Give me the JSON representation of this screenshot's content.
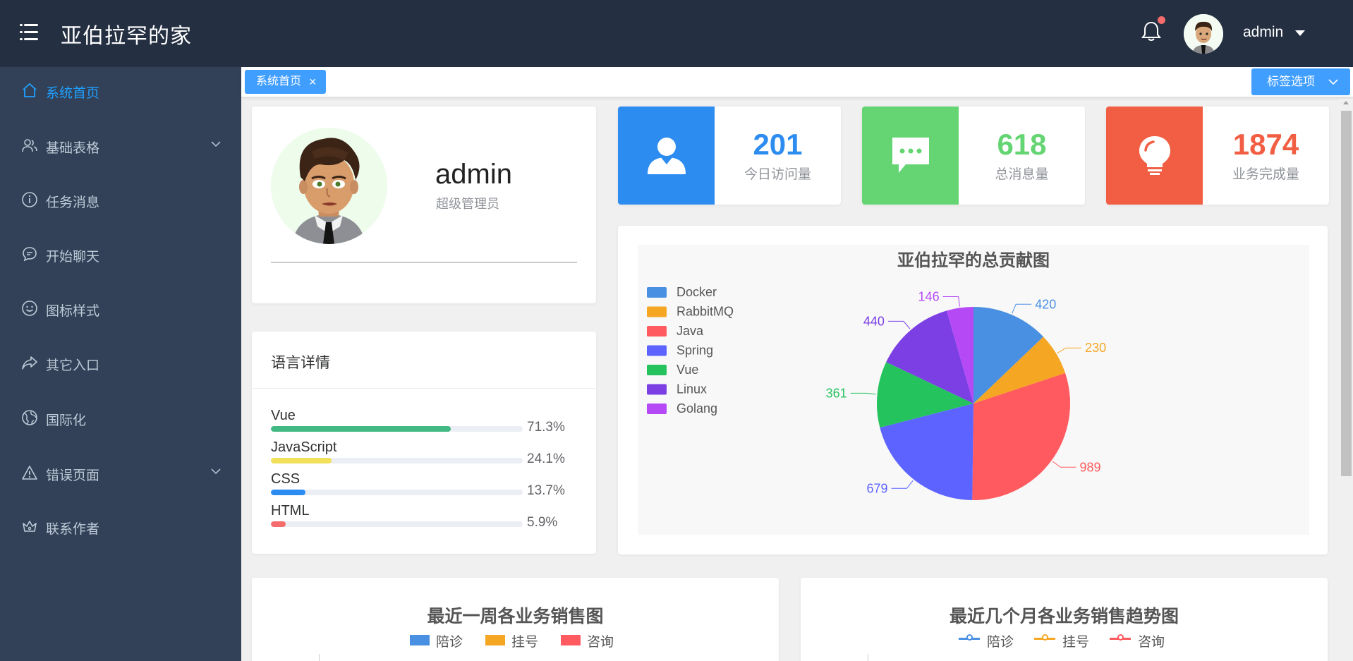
{
  "header": {
    "title": "亚伯拉罕的家",
    "user": "admin"
  },
  "sidebar": {
    "items": [
      {
        "label": "系统首页",
        "icon": "home-icon",
        "active": true,
        "expandable": false
      },
      {
        "label": "基础表格",
        "icon": "users-icon",
        "active": false,
        "expandable": true
      },
      {
        "label": "任务消息",
        "icon": "info-icon",
        "active": false,
        "expandable": false
      },
      {
        "label": "开始聊天",
        "icon": "chat-icon",
        "active": false,
        "expandable": false
      },
      {
        "label": "图标样式",
        "icon": "smile-icon",
        "active": false,
        "expandable": false
      },
      {
        "label": "其它入口",
        "icon": "share-icon",
        "active": false,
        "expandable": false
      },
      {
        "label": "国际化",
        "icon": "globe-icon",
        "active": false,
        "expandable": false
      },
      {
        "label": "错误页面",
        "icon": "warning-icon",
        "active": false,
        "expandable": true
      },
      {
        "label": "联系作者",
        "icon": "crown-icon",
        "active": false,
        "expandable": false
      }
    ]
  },
  "tags": {
    "items": [
      {
        "label": "系统首页",
        "close": "×"
      }
    ],
    "options_label": "标签选项"
  },
  "user_card": {
    "name": "admin",
    "role": "超级管理员"
  },
  "languages": {
    "title": "语言详情",
    "items": [
      {
        "name": "Vue",
        "percent": 71.3,
        "percent_label": "71.3%",
        "color": "#42b983"
      },
      {
        "name": "JavaScript",
        "percent": 24.1,
        "percent_label": "24.1%",
        "color": "#f1e05a"
      },
      {
        "name": "CSS",
        "percent": 13.7,
        "percent_label": "13.7%",
        "color": "#2d8cf0"
      },
      {
        "name": "HTML",
        "percent": 5.9,
        "percent_label": "5.9%",
        "color": "#f56c6c"
      }
    ]
  },
  "stats": [
    {
      "value": "201",
      "label": "今日访问量",
      "color": "#2d8cf0",
      "icon": "user-icon"
    },
    {
      "value": "618",
      "label": "总消息量",
      "color": "#64d572",
      "icon": "message-icon"
    },
    {
      "value": "1874",
      "label": "业务完成量",
      "color": "#f25e43",
      "icon": "lightbulb-icon"
    }
  ],
  "chart_data": [
    {
      "type": "pie",
      "title": "亚伯拉罕的总贡献图",
      "legend_position": "left",
      "slices": [
        {
          "name": "Docker",
          "value": 420,
          "color": "#4a90e2"
        },
        {
          "name": "RabbitMQ",
          "value": 230,
          "color": "#f5a623"
        },
        {
          "name": "Java",
          "value": 989,
          "color": "#ff5a5f"
        },
        {
          "name": "Spring",
          "value": 679,
          "color": "#5c63ff"
        },
        {
          "name": "Vue",
          "value": 361,
          "color": "#24c35e"
        },
        {
          "name": "Linux",
          "value": 440,
          "color": "#7b3fe4"
        },
        {
          "name": "Golang",
          "value": 146,
          "color": "#b549f5"
        }
      ]
    },
    {
      "type": "bar",
      "title": "最近一周各业务销售图",
      "series": [
        {
          "name": "陪诊",
          "color": "#4a90e2"
        },
        {
          "name": "挂号",
          "color": "#f5a623"
        },
        {
          "name": "咨询",
          "color": "#ff5a5f"
        }
      ]
    },
    {
      "type": "line",
      "title": "最近几个月各业务销售趋势图",
      "series": [
        {
          "name": "陪诊",
          "color": "#4a90e2"
        },
        {
          "name": "挂号",
          "color": "#f5a623"
        },
        {
          "name": "咨询",
          "color": "#ff5a5f"
        }
      ]
    }
  ]
}
